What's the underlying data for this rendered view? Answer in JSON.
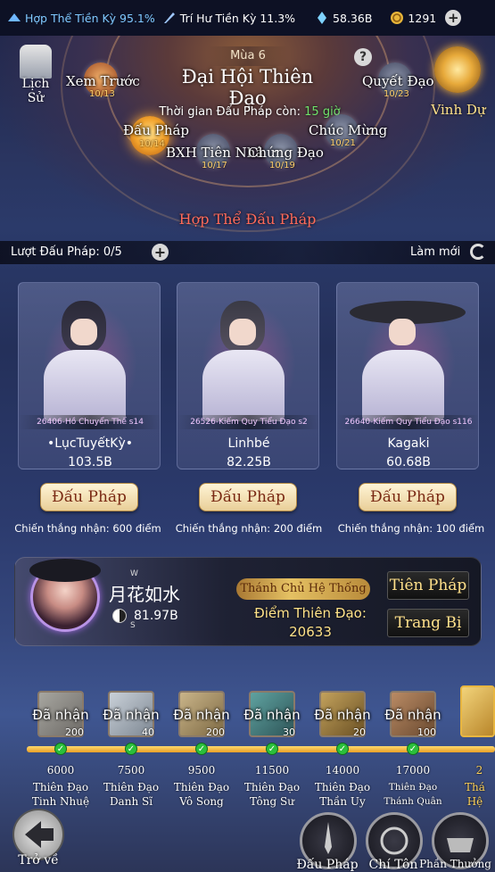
{
  "status": {
    "merge_progress": "Hợp Thể Tiền Kỳ 95.1%",
    "tri_progress": "Trí Hư Tiền Kỳ 11.3%",
    "spirit_stones": "58.36B",
    "coins": "1291",
    "add_label": "+"
  },
  "event": {
    "season": "Mùa 6",
    "title": "Đại Hội Thiên Đạo",
    "countdown_prefix": "Thời gian Đấu Pháp còn: ",
    "countdown_value": "15 giờ",
    "help": "?",
    "history_label": "Lịch Sử",
    "glory_label": "Vinh Dự",
    "mode_title": "Hợp Thể Đấu Pháp"
  },
  "stages": [
    {
      "name": "Xem Trước",
      "date": "10/13"
    },
    {
      "name": "Đấu Pháp",
      "date": "10/14"
    },
    {
      "name": "BXH Tiên Nhân",
      "date": "10/17"
    },
    {
      "name": "Chứng Đạo",
      "date": "10/19"
    },
    {
      "name": "Chúc Mừng",
      "date": "10/21"
    },
    {
      "name": "Quyết Đạo",
      "date": "10/23"
    }
  ],
  "turns": {
    "label": "Lượt Đấu Pháp: 0/5",
    "plus": "+",
    "refresh_label": "Làm mới"
  },
  "opponents": [
    {
      "server": "26406-Hồ Chuyển Thế s14",
      "name": "•LụcTuyếtKỳ•",
      "power": "103.5B",
      "button": "Đấu Pháp",
      "reward": "Chiến thắng nhận: 600 điểm"
    },
    {
      "server": "26526-Kiếm Quy Tiểu Đạo s2",
      "name": "Linhbé",
      "power": "82.25B",
      "button": "Đấu Pháp",
      "reward": "Chiến thắng nhận: 200 điểm"
    },
    {
      "server": "26640-Kiếm Quy Tiểu Đạo s116",
      "name": "Kagaki",
      "power": "60.68B",
      "button": "Đấu Pháp",
      "reward": "Chiến thắng nhận: 100 điểm"
    }
  ],
  "player": {
    "name": "月花如水",
    "power": "81.97B",
    "compass_w": "W",
    "compass_s": "S",
    "rank_title": "Thánh Chủ Hệ Thống",
    "points_label": "Điểm Thiên Đạo:",
    "points_value": "20633",
    "btn_skill": "Tiên Pháp",
    "btn_equip": "Trang Bị"
  },
  "milestones": [
    {
      "claim": "Đã nhận",
      "count": "200",
      "points": "6000",
      "title_top": "Thiên Đạo",
      "title_bottom": "Tinh Nhuệ"
    },
    {
      "claim": "Đã nhận",
      "count": "40",
      "points": "7500",
      "title_top": "Thiên Đạo",
      "title_bottom": "Danh Sĩ"
    },
    {
      "claim": "Đã nhận",
      "count": "200",
      "points": "9500",
      "title_top": "Thiên Đạo",
      "title_bottom": "Vô Song"
    },
    {
      "claim": "Đã nhận",
      "count": "30",
      "points": "11500",
      "title_top": "Thiên Đạo",
      "title_bottom": "Tông Sư"
    },
    {
      "claim": "Đã nhận",
      "count": "20",
      "points": "14000",
      "title_top": "Thiên Đạo",
      "title_bottom": "Thần Uy"
    },
    {
      "claim": "Đã nhận",
      "count": "100",
      "points": "17000",
      "title_top": "Thiên Đạo",
      "title_bottom": "Thánh Quân"
    }
  ],
  "milestone_partial": {
    "points": "2",
    "title_top": "Thá",
    "title_bottom": "Hệ"
  },
  "nav": {
    "back": "Trở về",
    "fight": "Đấu Pháp",
    "supreme": "Chí Tôn",
    "reward": "Phần Thưởng"
  },
  "colors": {
    "accent_gold": "#ffe28a",
    "mode_title_red": "#ff6a5a",
    "countdown_green": "#6fe36a"
  }
}
